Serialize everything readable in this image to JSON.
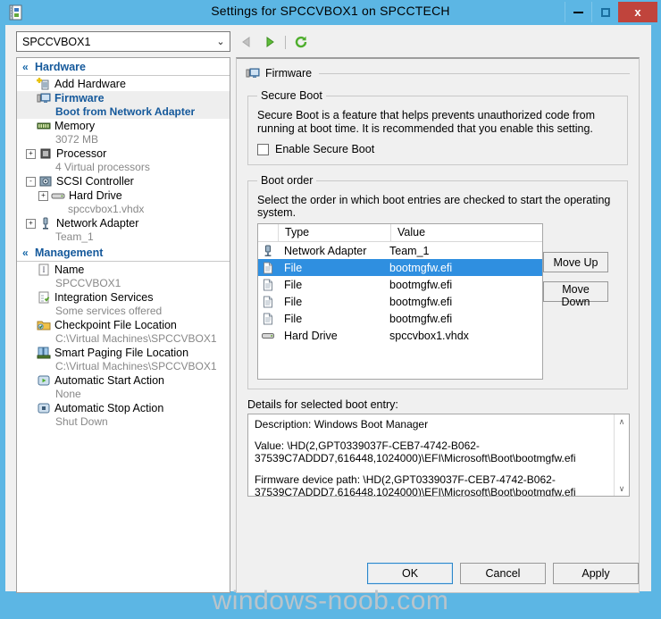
{
  "window": {
    "title": "Settings for SPCCVBOX1 on SPCCTECH",
    "icon": "settings-document-icon",
    "minimize_label": "Minimize",
    "maximize_label": "Maximize",
    "close_label": "x"
  },
  "toolbar": {
    "vm_selected": "SPCCVBOX1",
    "chevron": "⌄",
    "back_icon": "back-arrow-icon",
    "forward_icon": "forward-arrow-icon",
    "refresh_icon": "refresh-icon"
  },
  "sidebar": {
    "groups": [
      {
        "label": "Hardware",
        "chevron": "«",
        "items": [
          {
            "label": "Add Hardware",
            "sub": "",
            "icon": "add-hardware-icon",
            "expander": "",
            "selected": false,
            "indent": 0
          },
          {
            "label": "Firmware",
            "sub": "Boot from Network Adapter",
            "icon": "firmware-icon",
            "expander": "",
            "selected": true,
            "indent": 0
          },
          {
            "label": "Memory",
            "sub": "3072 MB",
            "icon": "memory-icon",
            "expander": "",
            "selected": false,
            "indent": 0
          },
          {
            "label": "Processor",
            "sub": "4 Virtual processors",
            "icon": "processor-icon",
            "expander": "+",
            "selected": false,
            "indent": 0
          },
          {
            "label": "SCSI Controller",
            "sub": "",
            "icon": "scsi-controller-icon",
            "expander": "-",
            "selected": false,
            "indent": 0
          },
          {
            "label": "Hard Drive",
            "sub": "spccvbox1.vhdx",
            "icon": "hard-drive-icon",
            "expander": "+",
            "selected": false,
            "indent": 1
          },
          {
            "label": "Network Adapter",
            "sub": "Team_1",
            "icon": "network-adapter-icon",
            "expander": "+",
            "selected": false,
            "indent": 0
          }
        ]
      },
      {
        "label": "Management",
        "chevron": "«",
        "items": [
          {
            "label": "Name",
            "sub": "SPCCVBOX1",
            "icon": "name-icon",
            "expander": "",
            "selected": false,
            "indent": 0
          },
          {
            "label": "Integration Services",
            "sub": "Some services offered",
            "icon": "integration-services-icon",
            "expander": "",
            "selected": false,
            "indent": 0
          },
          {
            "label": "Checkpoint File Location",
            "sub": "C:\\Virtual Machines\\SPCCVBOX1",
            "icon": "checkpoint-icon",
            "expander": "",
            "selected": false,
            "indent": 0
          },
          {
            "label": "Smart Paging File Location",
            "sub": "C:\\Virtual Machines\\SPCCVBOX1",
            "icon": "smart-paging-icon",
            "expander": "",
            "selected": false,
            "indent": 0
          },
          {
            "label": "Automatic Start Action",
            "sub": "None",
            "icon": "automatic-start-icon",
            "expander": "",
            "selected": false,
            "indent": 0
          },
          {
            "label": "Automatic Stop Action",
            "sub": "Shut Down",
            "icon": "automatic-stop-icon",
            "expander": "",
            "selected": false,
            "indent": 0
          }
        ]
      }
    ]
  },
  "main": {
    "header": {
      "title": "Firmware",
      "icon": "firmware-icon"
    },
    "secure_boot": {
      "legend": "Secure Boot",
      "description": "Secure Boot is a feature that helps prevents unauthorized code from running at boot time. It is recommended that you enable this setting.",
      "checkbox_label": "Enable Secure Boot",
      "checked": false
    },
    "boot_order": {
      "legend": "Boot order",
      "hint": "Select the order in which boot entries are checked to start the operating system.",
      "columns": [
        "",
        "Type",
        "Value"
      ],
      "rows": [
        {
          "icon": "network-adapter-icon",
          "type": "Network Adapter",
          "value": "Team_1",
          "selected": false
        },
        {
          "icon": "file-icon",
          "type": "File",
          "value": "bootmgfw.efi",
          "selected": true
        },
        {
          "icon": "file-icon",
          "type": "File",
          "value": "bootmgfw.efi",
          "selected": false
        },
        {
          "icon": "file-icon",
          "type": "File",
          "value": "bootmgfw.efi",
          "selected": false
        },
        {
          "icon": "file-icon",
          "type": "File",
          "value": "bootmgfw.efi",
          "selected": false
        },
        {
          "icon": "hard-drive-icon",
          "type": "Hard Drive",
          "value": "spccvbox1.vhdx",
          "selected": false
        }
      ],
      "move_up_label": "Move Up",
      "move_down_label": "Move Down"
    },
    "details": {
      "label": "Details for selected boot entry:",
      "lines": [
        "Description: Windows Boot Manager",
        "Value: \\HD(2,GPT0339037F-CEB7-4742-B062-37539C7ADDD7,616448,1024000)\\EFI\\Microsoft\\Boot\\bootmgfw.efi",
        "Firmware device path: \\HD(2,GPT0339037F-CEB7-4742-B062-37539C7ADDD7,616448,1024000)\\EFI\\Microsoft\\Boot\\bootmgfw.efi"
      ],
      "scroll_up": "∧",
      "scroll_down": "∨"
    }
  },
  "footer": {
    "ok_label": "OK",
    "cancel_label": "Cancel",
    "apply_label": "Apply"
  },
  "watermark": "windows-noob.com",
  "colors": {
    "titlebar": "#5cb6e4",
    "close_button": "#c0443c",
    "selection": "#2f8fe0",
    "link_blue": "#15599b"
  }
}
